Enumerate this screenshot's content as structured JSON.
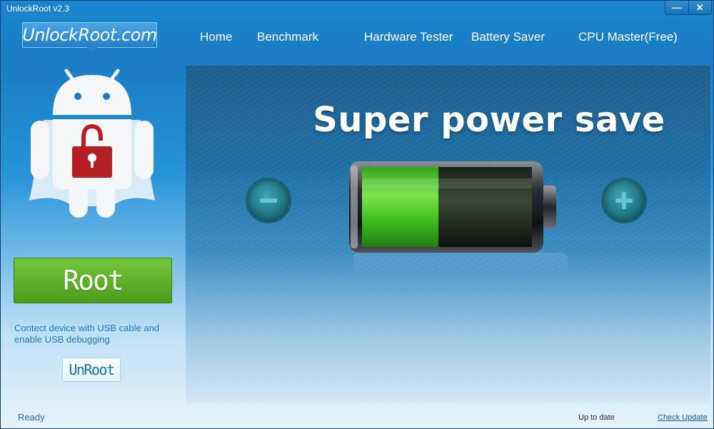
{
  "window": {
    "title": "UnlockRoot v2.3",
    "minimize_label": "—",
    "close_label": "✕"
  },
  "logo": {
    "text": "UnlockRoot.com"
  },
  "nav": {
    "items": [
      "Home",
      "Benchmark",
      "Hardware Tester",
      "Battery Saver",
      "CPU Master(Free)"
    ]
  },
  "left": {
    "root_label": "Root",
    "instructions": "Contect device with USB cable and enable USB debugging",
    "unroot_label": "UnRoot"
  },
  "main": {
    "title": "Super power save",
    "battery_level": 0.45,
    "minus_icon": "minus-icon",
    "plus_icon": "plus-icon"
  },
  "status": {
    "left": "Ready",
    "update_status": "Up to date",
    "check_update": "Check Update"
  },
  "colors": {
    "accent": "#1a86cf",
    "root_green": "#5aaf27",
    "battery_green": "#3ec51e"
  }
}
